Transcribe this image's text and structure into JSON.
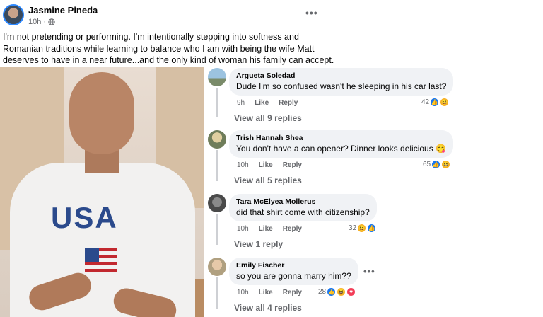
{
  "post": {
    "author": "Jasmine Pineda",
    "time": "10h",
    "privacy_icon": "globe-icon",
    "more_icon": "•••",
    "text": "I'm not pretending or performing. I'm intentionally stepping into softness and Romanian traditions while learning to balance who I am with  being the wife Matt deserves to have in a near future...and the only kind of woman his family can accept."
  },
  "comments": [
    {
      "name": "Argueta Soledad",
      "text": "Dude I'm so confused wasn't he sleeping in his car last?",
      "time": "9h",
      "like": "Like",
      "reply": "Reply",
      "count": "42",
      "reactions": [
        "like",
        "haha"
      ],
      "replies": "View all 9 replies"
    },
    {
      "name": "Trish Hannah Shea",
      "text": "You don't have a can opener? Dinner looks delicious 😋",
      "time": "10h",
      "like": "Like",
      "reply": "Reply",
      "count": "65",
      "reactions": [
        "like",
        "haha"
      ],
      "replies": "View all 5 replies"
    },
    {
      "name": "Tara McElyea Mollerus",
      "text": "did that shirt come with citizenship?",
      "time": "10h",
      "like": "Like",
      "reply": "Reply",
      "count": "32",
      "reactions": [
        "haha",
        "like"
      ],
      "replies": "View 1 reply"
    },
    {
      "name": "Emily Fischer",
      "text": "so you are gonna marry him??",
      "time": "10h",
      "like": "Like",
      "reply": "Reply",
      "count": "28",
      "reactions": [
        "like",
        "haha",
        "love"
      ],
      "replies": "View all 4 replies",
      "more": "•••"
    }
  ],
  "colors": {
    "bubble": "#f0f2f5",
    "meta": "#65676b",
    "like": "#1877f2",
    "haha": "#f7b125",
    "love": "#f33e58"
  }
}
